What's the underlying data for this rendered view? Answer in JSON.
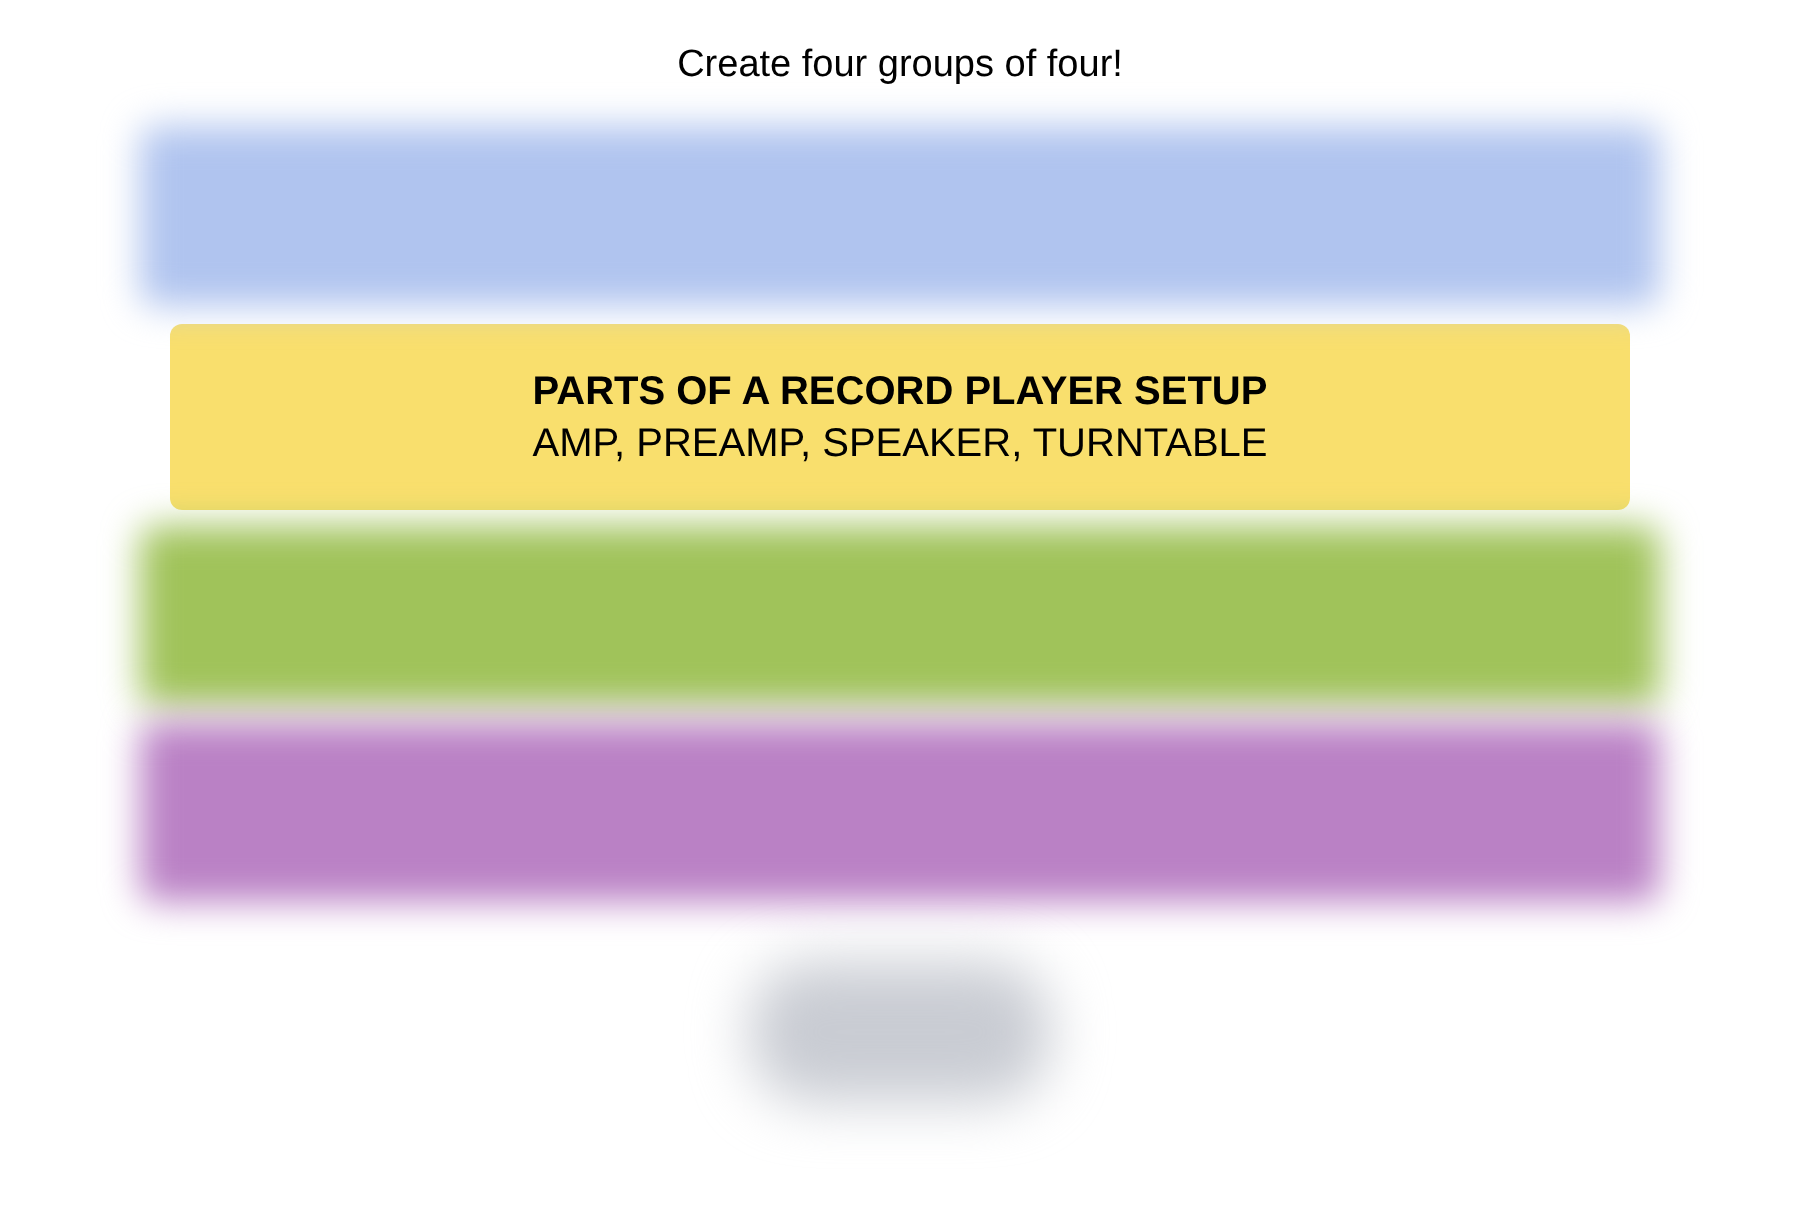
{
  "heading": "Create four groups of four!",
  "groups": [
    {
      "kind": "blurred",
      "color": "#b0c4ef"
    },
    {
      "kind": "solved",
      "color": "#f9df6d",
      "title": "PARTS OF A RECORD PLAYER SETUP",
      "members": "AMP, PREAMP, SPEAKER, TURNTABLE"
    },
    {
      "kind": "blurred",
      "color": "#a0c35a"
    },
    {
      "kind": "blurred",
      "color": "#ba81c5"
    }
  ],
  "footer_blurred": true
}
